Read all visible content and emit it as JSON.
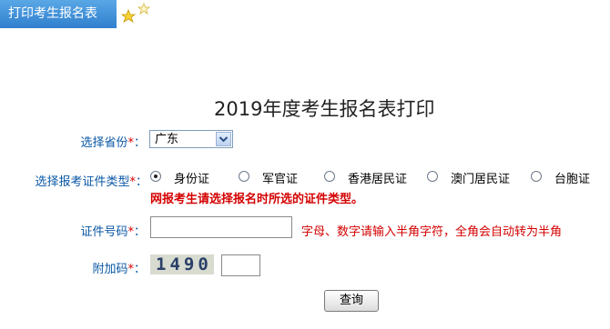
{
  "tab": {
    "title": "打印考生报名表"
  },
  "page_title": "2019年度考生报名表打印",
  "required_mark": "*",
  "province": {
    "label": "选择省份",
    "colon": "：",
    "selected": "广东"
  },
  "id_type": {
    "label": "选择报考证件类型",
    "colon": "：",
    "options": [
      {
        "label": "身份证",
        "checked": true
      },
      {
        "label": "军官证",
        "checked": false
      },
      {
        "label": "香港居民证",
        "checked": false
      },
      {
        "label": "澳门居民证",
        "checked": false
      },
      {
        "label": "台胞证",
        "checked": false
      }
    ],
    "hint": "网报考生请选择报名时所选的证件类型。"
  },
  "id_number": {
    "label": "证件号码",
    "colon": "：",
    "value": "",
    "hint": "字母、数字请输入半角字符，全角会自动转为半角"
  },
  "captcha": {
    "label": "附加码",
    "colon": "：",
    "image_text": "1490",
    "value": ""
  },
  "submit": {
    "label": "查询"
  },
  "colors": {
    "tab": "#3a8ad6",
    "label": "#0a57a6",
    "required": "#d40000"
  },
  "icons": [
    "star-icon",
    "star-outline-icon",
    "chevron-down-icon"
  ]
}
